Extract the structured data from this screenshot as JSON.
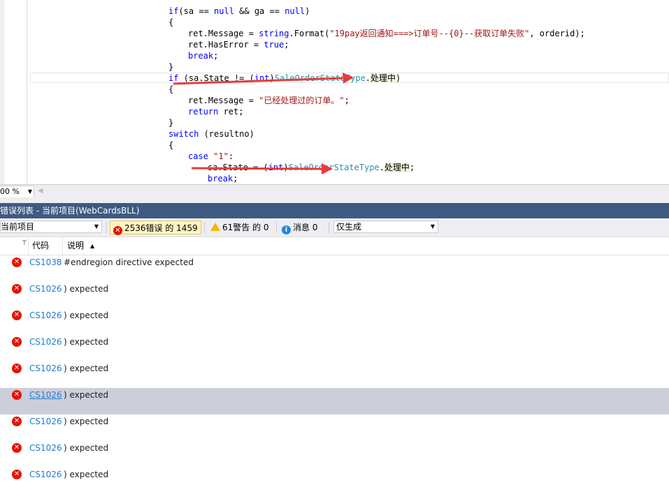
{
  "editor": {
    "lines": [
      {
        "indent": "        ",
        "parts": [
          [
            "kw",
            "if"
          ],
          [
            "",
            "(sa == "
          ],
          [
            "kw",
            "null"
          ],
          [
            "",
            " && ga == "
          ],
          [
            "kw",
            "null"
          ],
          [
            "",
            ")"
          ]
        ]
      },
      {
        "indent": "        ",
        "parts": [
          [
            "",
            "{"
          ]
        ]
      },
      {
        "indent": "            ",
        "parts": [
          [
            "",
            "ret.Message = "
          ],
          [
            "kw",
            "string"
          ],
          [
            "",
            ".Format("
          ],
          [
            "str",
            "\"19pay返回通知===>订单号--{0}--获取订单失败\""
          ],
          [
            "",
            ", orderid);"
          ]
        ]
      },
      {
        "indent": "            ",
        "parts": [
          [
            "",
            "ret.HasError = "
          ],
          [
            "kw",
            "true"
          ],
          [
            "",
            ";"
          ]
        ]
      },
      {
        "indent": "            ",
        "parts": [
          [
            "kw",
            "break"
          ],
          [
            "",
            ";"
          ]
        ]
      },
      {
        "indent": "        ",
        "parts": [
          [
            "",
            "}"
          ]
        ]
      },
      {
        "indent": "        ",
        "parts": [
          [
            "kw",
            "if"
          ],
          [
            "",
            " (sa.State != ("
          ],
          [
            "kw",
            "int"
          ],
          [
            "",
            ")"
          ],
          [
            "ty",
            "SaleOrderStateType"
          ],
          [
            "",
            "."
          ],
          [
            "hl",
            "处理中"
          ],
          [
            "",
            ")"
          ]
        ]
      },
      {
        "indent": "        ",
        "parts": [
          [
            "",
            "{"
          ]
        ]
      },
      {
        "indent": "            ",
        "parts": [
          [
            "",
            "ret.Message = "
          ],
          [
            "str",
            "\"已经处理过的订单。\""
          ],
          [
            "",
            ";"
          ]
        ]
      },
      {
        "indent": "            ",
        "parts": [
          [
            "kw",
            "return"
          ],
          [
            "",
            " ret;"
          ]
        ]
      },
      {
        "indent": "        ",
        "parts": [
          [
            "",
            "}"
          ]
        ]
      },
      {
        "indent": "        ",
        "parts": [
          [
            "kw",
            "switch"
          ],
          [
            "",
            " (resultno)"
          ]
        ]
      },
      {
        "indent": "        ",
        "parts": [
          [
            "",
            "{"
          ]
        ]
      },
      {
        "indent": "            ",
        "parts": [
          [
            "kw",
            "case"
          ],
          [
            "",
            ""
          ],
          [
            "str",
            " \"1\""
          ],
          [
            "",
            ":"
          ]
        ]
      },
      {
        "indent": "                ",
        "parts": [
          [
            "",
            "sa.State = ("
          ],
          [
            "kw",
            "int"
          ],
          [
            "",
            ")"
          ],
          [
            "ty",
            "SaleOrderStateType"
          ],
          [
            "",
            "."
          ],
          [
            "hl",
            "处理中"
          ],
          [
            "",
            ";"
          ]
        ]
      },
      {
        "indent": "                ",
        "parts": [
          [
            "kw",
            "break"
          ],
          [
            "",
            ";"
          ]
        ]
      }
    ]
  },
  "zoom": {
    "value": "00 %"
  },
  "panel": {
    "title": "错误列表 - 当前项目(WebCardsBLL)"
  },
  "toolbar": {
    "scope": "当前项目",
    "errors": "2536错误 的 1459",
    "warnings": "61警告 的 0",
    "messages": "消息 0",
    "filter": "仅生成"
  },
  "columns": {
    "code": "代码",
    "desc": "说明",
    "sort": "▲"
  },
  "rows": [
    {
      "code": "CS1038",
      "desc": "#endregion directive expected"
    },
    {
      "code": "CS1026",
      "desc": ") expected"
    },
    {
      "code": "CS1026",
      "desc": ") expected"
    },
    {
      "code": "CS1026",
      "desc": ") expected"
    },
    {
      "code": "CS1026",
      "desc": ") expected"
    },
    {
      "code": "CS1026",
      "desc": ") expected"
    },
    {
      "code": "CS1026",
      "desc": ") expected"
    },
    {
      "code": "CS1026",
      "desc": ") expected"
    },
    {
      "code": "CS1026",
      "desc": ") expected"
    }
  ],
  "selected_row": 5,
  "colors": {
    "accent": "#3e5a82",
    "error": "#e51400",
    "link": "#1e7bd8",
    "arrow": "#e83b3b"
  }
}
